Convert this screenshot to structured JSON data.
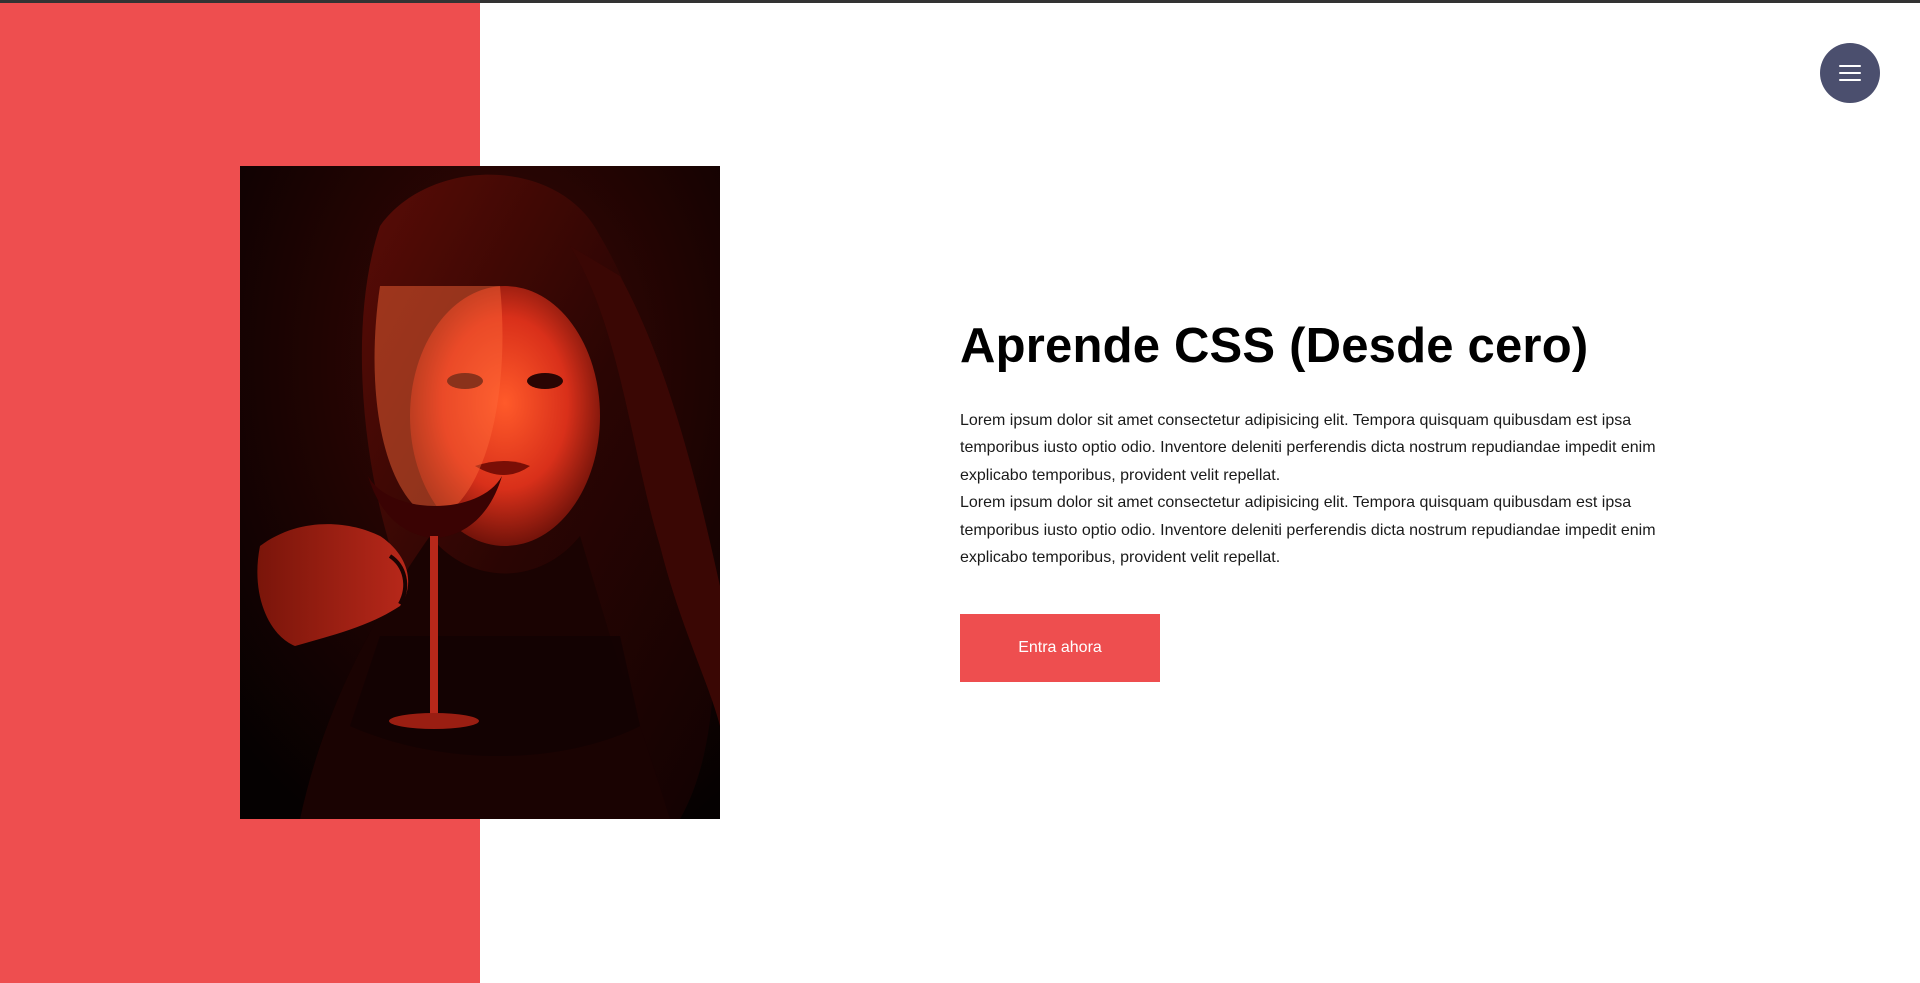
{
  "hero": {
    "title": "Aprende CSS (Desde cero)",
    "paragraphs": [
      "Lorem ipsum dolor sit amet consectetur adipisicing elit. Tempora quisquam quibusdam est ipsa temporibus iusto optio odio. Inventore deleniti perferendis dicta nostrum repudiandae impedit enim explicabo temporibus, provident velit repellat.",
      "Lorem ipsum dolor sit amet consectetur adipisicing elit. Tempora quisquam quibusdam est ipsa temporibus iusto optio odio. Inventore deleniti perferendis dicta nostrum repudiandae impedit enim explicabo temporibus, provident velit repellat."
    ],
    "cta_label": "Entra ahora"
  },
  "menu": {
    "icon": "hamburger-menu-icon"
  },
  "colors": {
    "accent": "#ee4e4f",
    "menu_button": "#4b4f6e",
    "background": "#ffffff"
  }
}
